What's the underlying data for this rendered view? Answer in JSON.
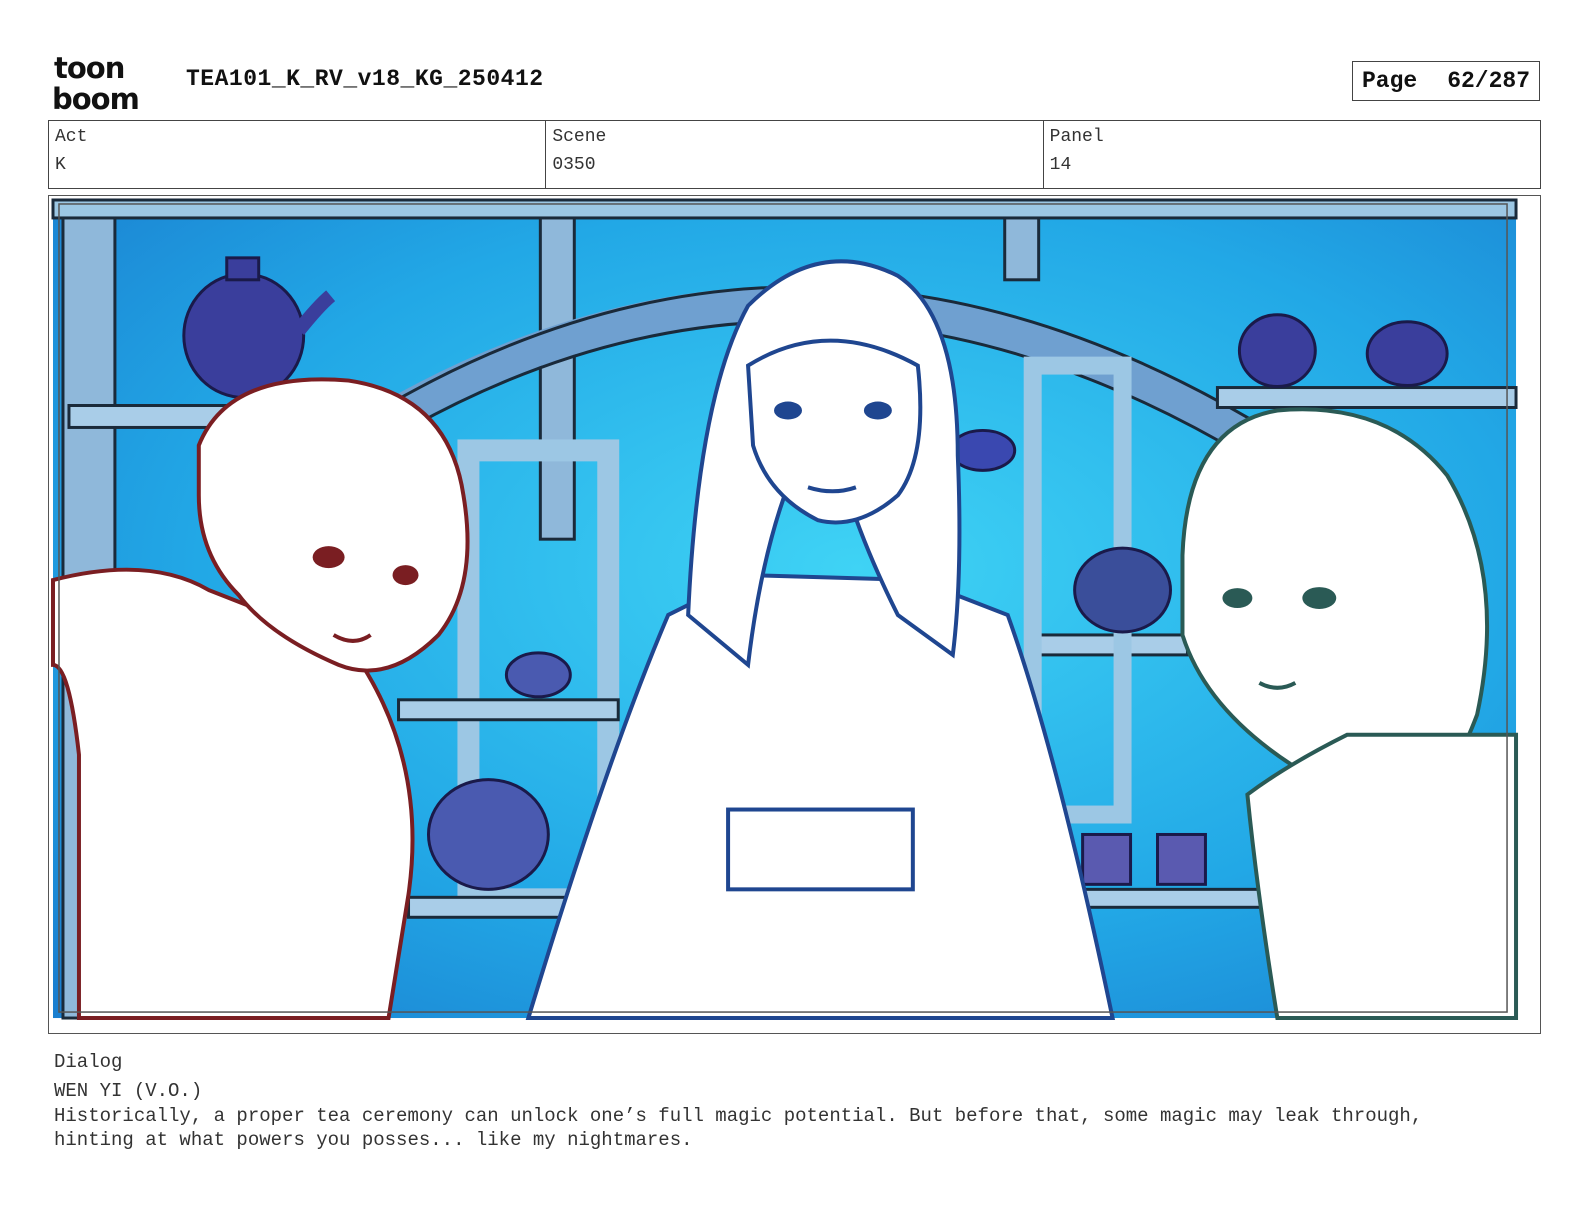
{
  "header": {
    "logo_line1": "toon",
    "logo_line2": "boom",
    "document_title": "TEA101_K_RV_v18_KG_250412",
    "page_label": "Page",
    "page_value": "62/287"
  },
  "info": {
    "act_label": "Act",
    "act_value": "K",
    "scene_label": "Scene",
    "scene_value": "0350",
    "panel_label": "Panel",
    "panel_value": "14"
  },
  "dialog": {
    "label": "Dialog",
    "speaker": "WEN YI (V.O.)",
    "text": "Historically, a proper tea ceremony can unlock one’s full magic potential. But before that, some magic may leak through,\nhinting at what powers you posses... like my nightmares."
  },
  "colors": {
    "background_blue": "#27b4ec",
    "shelf_blue": "#9ccbe6",
    "pottery_indigo": "#3a3e9c",
    "left_character_line": "#7a1e22",
    "center_character_line": "#1f4690",
    "right_character_line": "#2a5a55"
  }
}
